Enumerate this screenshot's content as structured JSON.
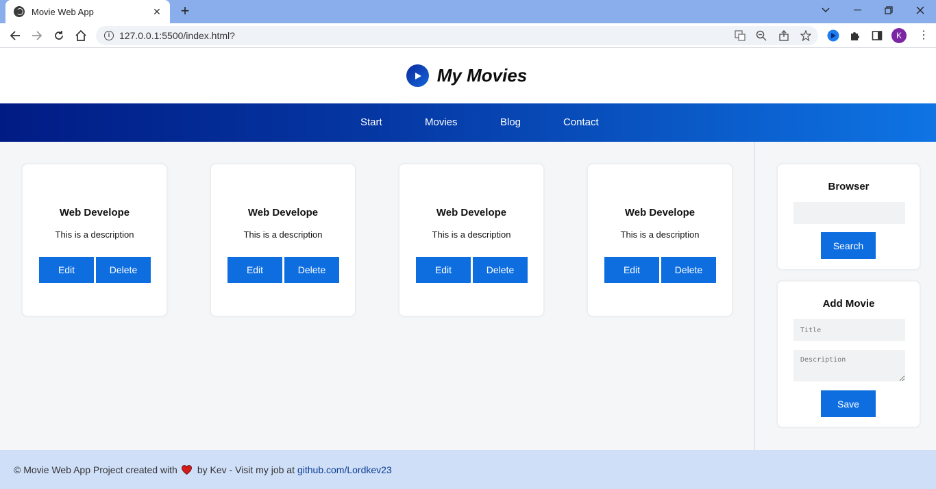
{
  "browser": {
    "tab_title": "Movie Web App",
    "tab_close": "✕",
    "new_tab": "+",
    "url": "127.0.0.1:5500/index.html?",
    "profile_initial": "K"
  },
  "header": {
    "brand": "My Movies"
  },
  "nav": {
    "items": [
      "Start",
      "Movies",
      "Blog",
      "Contact"
    ]
  },
  "cards": [
    {
      "title": "Web Develope",
      "description": "This is a description",
      "edit_label": "Edit",
      "delete_label": "Delete"
    },
    {
      "title": "Web Develope",
      "description": "This is a description",
      "edit_label": "Edit",
      "delete_label": "Delete"
    },
    {
      "title": "Web Develope",
      "description": "This is a description",
      "edit_label": "Edit",
      "delete_label": "Delete"
    },
    {
      "title": "Web Develope",
      "description": "This is a description",
      "edit_label": "Edit",
      "delete_label": "Delete"
    }
  ],
  "sidebar": {
    "browser": {
      "heading": "Browser",
      "search_value": "",
      "search_label": "Search"
    },
    "add_movie": {
      "heading": "Add Movie",
      "title_placeholder": "Title",
      "description_placeholder": "Description",
      "save_label": "Save"
    }
  },
  "footer": {
    "text_before": "© Movie Web App Project created with",
    "text_after": "by Kev - Visit my job at",
    "link_text": "github.com/Lordkev23"
  },
  "colors": {
    "accent": "#0e6ee0",
    "heart": "#d61a1a"
  }
}
